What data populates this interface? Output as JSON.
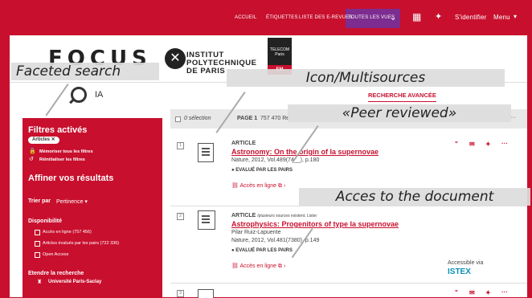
{
  "nav": {
    "links": [
      "ACCUEIL",
      "ÉTIQUETTES",
      "LISTE DES E-REVUES",
      "TOUTES LES VUES"
    ],
    "signin": "S'identifier",
    "menu": "Menu"
  },
  "logos": {
    "focus": "FOCUS",
    "ipp_line1": "INSTITUT",
    "ipp_line2": "POLYTECHNIQUE",
    "ipp_line3": "DE PARIS",
    "telecom": "TELECOM",
    "telecom_sub": "Paris"
  },
  "search": {
    "value": "IA",
    "advanced": "RECHERCHE AVANCÉE"
  },
  "sidebar": {
    "active_title": "Filtres activés",
    "chip": "Articles",
    "memorize": "Mémoriser tous les filtres",
    "reset": "Réinitialiser les filtres",
    "refine": "Affiner vos résultats",
    "sort_label": "Trier par",
    "sort_value": "Pertinence",
    "availability": "Disponibilité",
    "options": [
      {
        "label": "Accès en ligne",
        "count": "(757 456)"
      },
      {
        "label": "Articles évalués par les pairs",
        "count": "(722 336)"
      },
      {
        "label": "Open Access",
        "count": ""
      }
    ],
    "extend": "Etendre la recherche",
    "university": "Université Paris-Saclay"
  },
  "results_bar": {
    "selected": "0 sélection",
    "page": "PAGE 1",
    "count": "757 470 Ré"
  },
  "results": [
    {
      "num": "1",
      "type": "ARTICLE",
      "type_extra": "",
      "title": "Astronomy: On the origin of Ia supernovae",
      "author": "",
      "source": "Nature, 2012, Vol.489(74__), p.180",
      "peer": "EVALUÉ PAR LES PAIRS",
      "access": "Accès en ligne"
    },
    {
      "num": "2",
      "type": "ARTICLE",
      "type_extra": "/plusieurs sources existent. Lister",
      "title": "Astrophysics: Progenitors of type Ia supernovae",
      "author": "Pilar Ruiz-Lapuente",
      "source": "Nature, 2012, Vol.481(7380), p.149",
      "peer": "EVALUÉ PAR LES PAIRS",
      "access": "Accès en ligne"
    },
    {
      "num": "3"
    }
  ],
  "istex": {
    "line1": "Accessible via",
    "line2": "ISTEX"
  },
  "annotations": {
    "faceted": "Faceted search",
    "multisources": "Icon/Multisources",
    "peer": "«Peer reviewed»",
    "access": "Acces to the document"
  },
  "colors": {
    "brand": "#c8102e",
    "nav_active": "#7d2c8f",
    "istex": "#0a8fb5"
  }
}
